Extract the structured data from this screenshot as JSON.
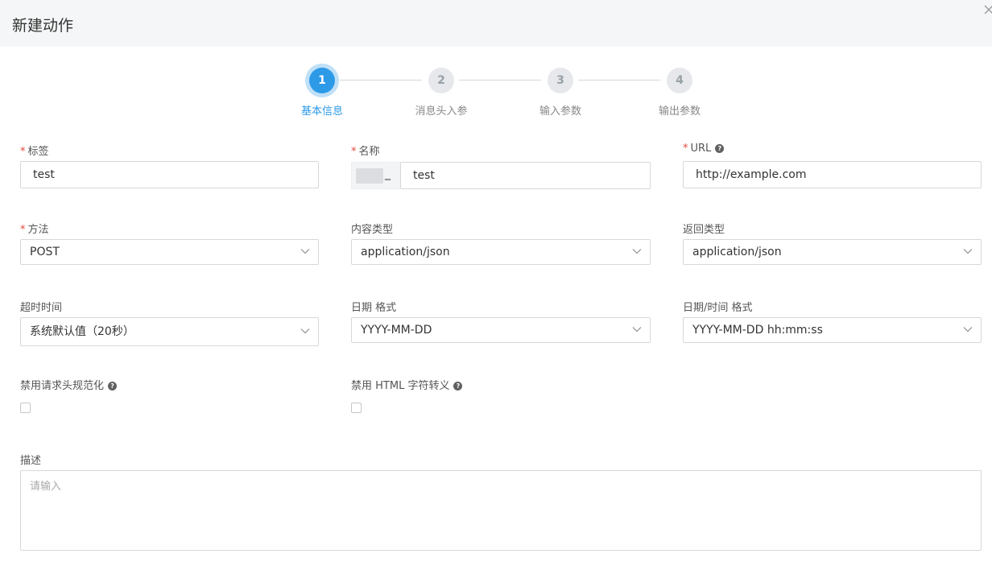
{
  "dialog": {
    "title": "新建动作"
  },
  "steps": [
    {
      "number": "1",
      "label": "基本信息"
    },
    {
      "number": "2",
      "label": "消息头入参"
    },
    {
      "number": "3",
      "label": "输入参数"
    },
    {
      "number": "4",
      "label": "输出参数"
    }
  ],
  "active_step": 1,
  "form": {
    "label": {
      "label": "标签",
      "value": "test"
    },
    "name": {
      "label": "名称",
      "prefix": "_",
      "value": "test"
    },
    "url": {
      "label": "URL",
      "value": "http://example.com"
    },
    "method": {
      "label": "方法",
      "value": "POST"
    },
    "content_type": {
      "label": "内容类型",
      "value": "application/json"
    },
    "return_type": {
      "label": "返回类型",
      "value": "application/json"
    },
    "timeout": {
      "label": "超时时间",
      "value": "系统默认值（20秒）"
    },
    "date_format": {
      "label": "日期 格式",
      "value": "YYYY-MM-DD"
    },
    "datetime_format": {
      "label": "日期/时间 格式",
      "value": "YYYY-MM-DD hh:mm:ss"
    },
    "disable_header_normalization": {
      "label": "禁用请求头规范化",
      "checked": false
    },
    "disable_html_escape": {
      "label": "禁用 HTML 字符转义",
      "checked": false
    },
    "description": {
      "label": "描述",
      "placeholder": "请输入",
      "value": ""
    }
  },
  "required_marker": "*",
  "help_glyph": "?",
  "colors": {
    "accent": "#2d9ae8",
    "required": "#e5473d",
    "header_bg": "#f5f6f7"
  }
}
